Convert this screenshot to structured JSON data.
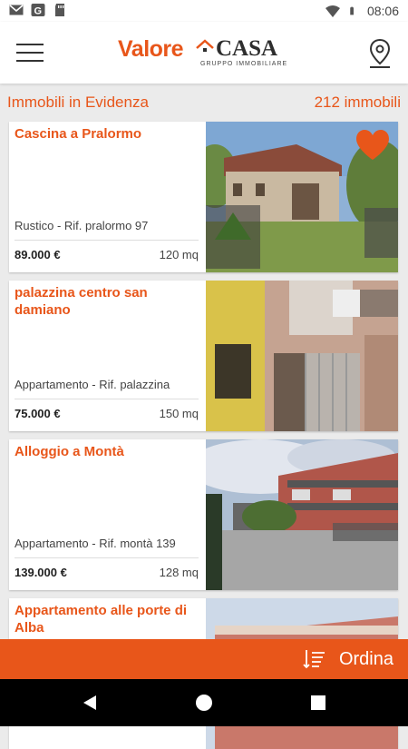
{
  "status_bar": {
    "time": "08:06",
    "left_icons": [
      "gmail-icon",
      "google-icon",
      "sd-card-icon"
    ],
    "right_icons": [
      "wifi-icon",
      "battery-icon"
    ]
  },
  "app_bar": {
    "logo_primary": "Valore",
    "logo_secondary": "CASA",
    "logo_tagline": "GRUPPO IMMOBILIARE",
    "brand_color": "#e8561a"
  },
  "list_header": {
    "title": "Immobili in Evidenza",
    "count": "212 immobili"
  },
  "listings": [
    {
      "title": "Cascina a Pralormo",
      "description": "Rustico - Rif. pralormo 97",
      "price": "89.000 €",
      "area": "120 mq",
      "favorite": true
    },
    {
      "title": "palazzina centro san damiano",
      "description": "Appartamento - Rif. palazzina",
      "price": "75.000 €",
      "area": "150 mq",
      "favorite": false
    },
    {
      "title": "Alloggio a Montà",
      "description": "Appartamento - Rif. montà 139",
      "price": "139.000 €",
      "area": "128 mq",
      "favorite": false
    },
    {
      "title": "Appartamento alle porte di Alba",
      "description": "",
      "price": "",
      "area": "",
      "favorite": false
    }
  ],
  "sort_bar": {
    "label": "Ordina"
  }
}
